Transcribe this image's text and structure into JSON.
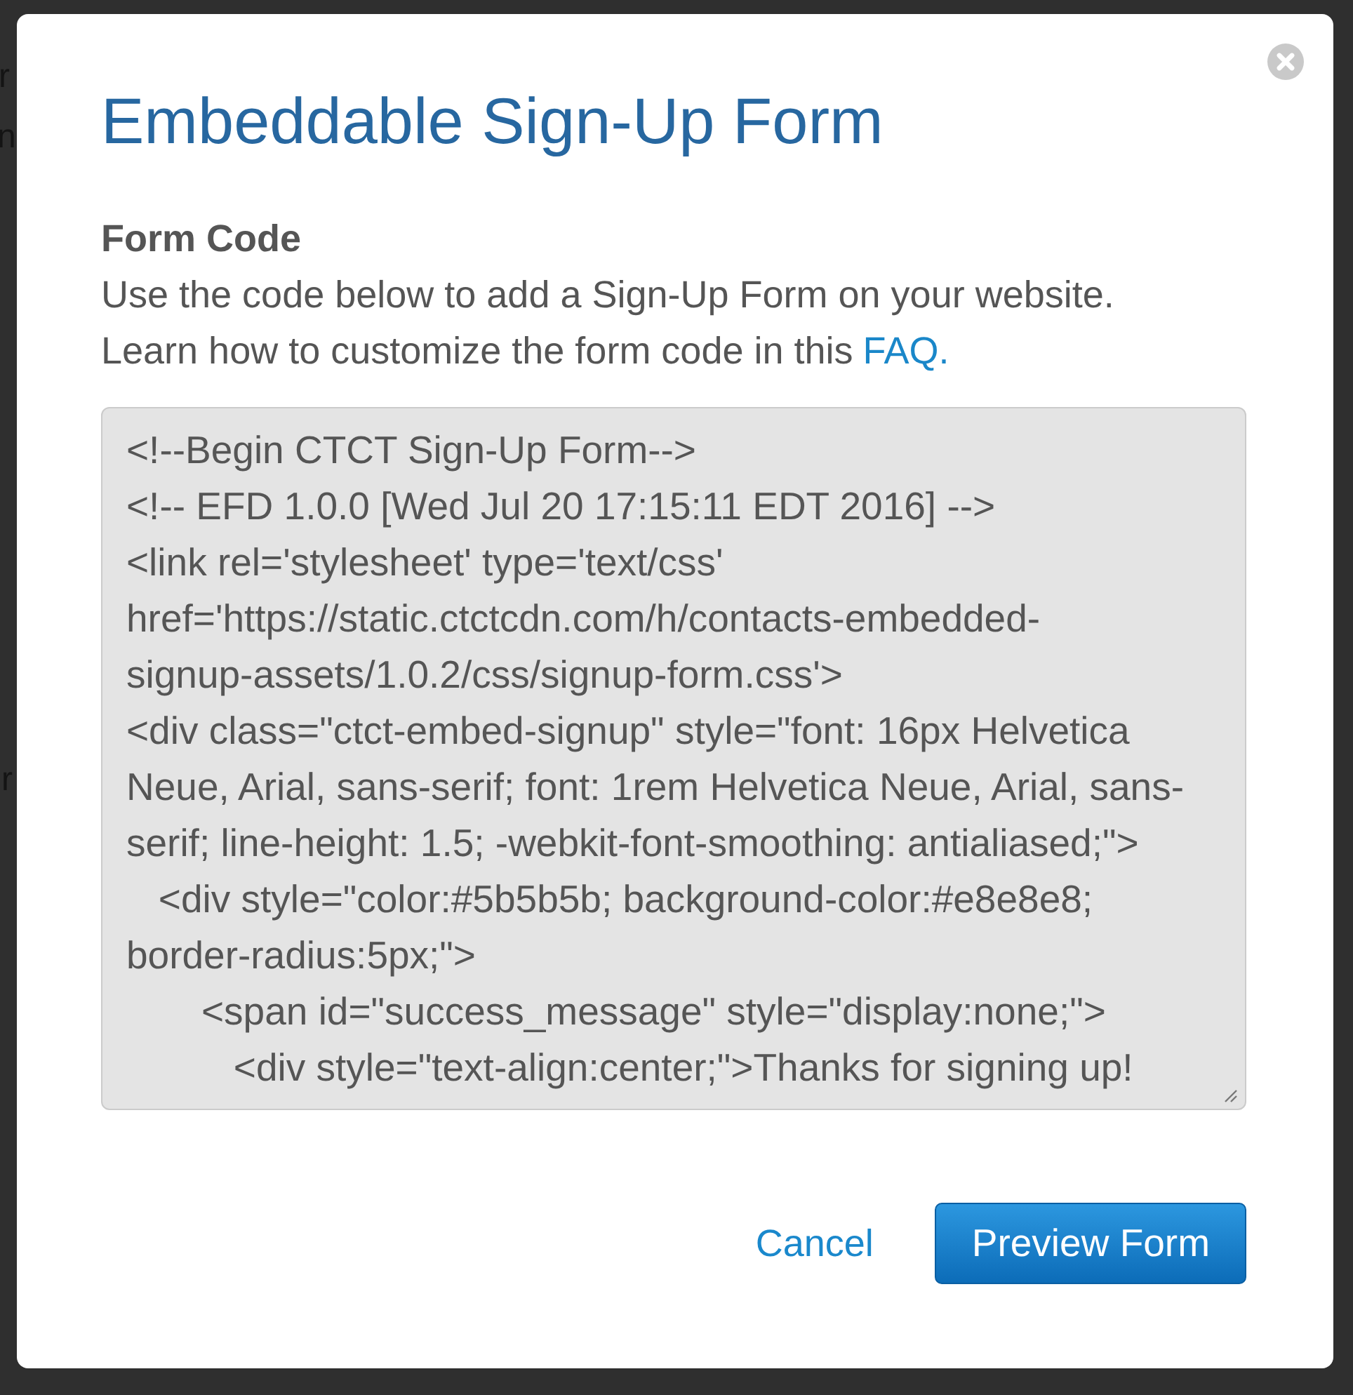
{
  "backdrop": {
    "texts": [
      "r",
      "n",
      "r"
    ]
  },
  "dialog": {
    "title": "Embeddable Sign-Up Form",
    "section": {
      "heading": "Form Code",
      "lines": [
        "Use the code below to add a Sign-Up Form on your website.",
        "Learn how to customize the form code in this"
      ],
      "link": "FAQ."
    },
    "code_field": {
      "value_lines": [
        "<!--Begin CTCT Sign-Up Form-->",
        "<!-- EFD 1.0.0 [Wed Jul 20 17:15:11 EDT 2016] -->",
        "<link rel='stylesheet' type='text/css'",
        "href='https://static.ctctcdn.com/h/contacts-embedded-",
        "signup-assets/1.0.2/css/signup-form.css'>",
        "<div class=\"ctct-embed-signup\" style=\"font: 16px Helvetica",
        "Neue, Arial, sans-serif; font: 1rem Helvetica Neue, Arial, sans-",
        "serif; line-height: 1.5; -webkit-font-smoothing: antialiased;\">",
        "   <div style=\"color:#5b5b5b; background-color:#e8e8e8;",
        "border-radius:5px;\">",
        "       <span id=\"success_message\" style=\"display:none;\">",
        "          <div style=\"text-align:center;\">Thanks for signing up!"
      ]
    },
    "actions": [
      {
        "label": "Cancel",
        "kind": "link"
      },
      {
        "label": "Preview Form",
        "kind": "primary"
      }
    ]
  }
}
